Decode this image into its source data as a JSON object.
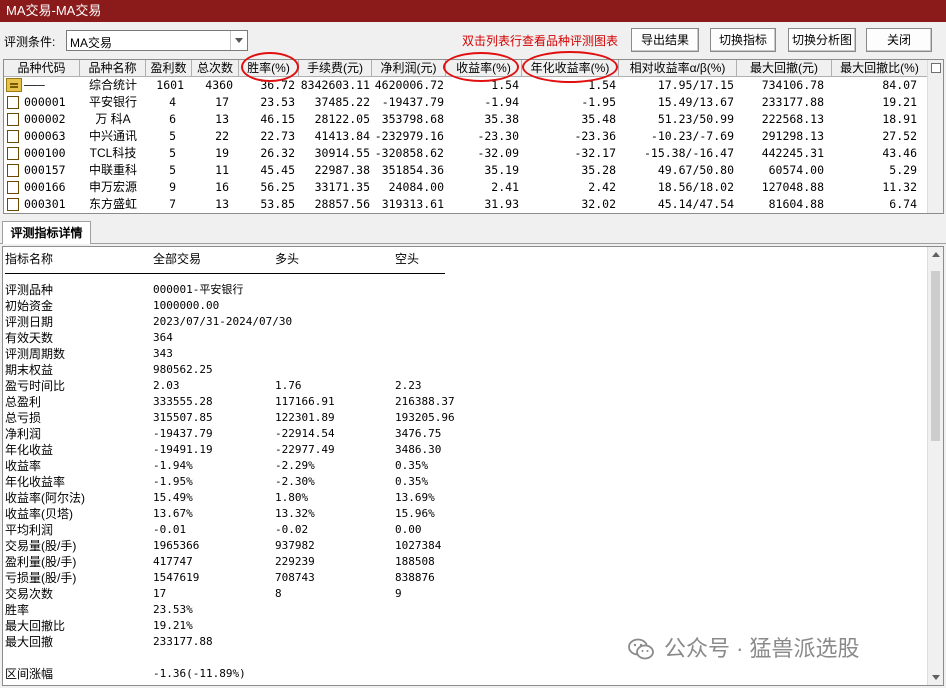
{
  "window": {
    "title": "MA交易-MA交易"
  },
  "toolbar": {
    "condition_label": "评测条件:",
    "condition_value": "MA交易",
    "hint": "双击列表行查看品种评测图表",
    "export_label": "导出结果",
    "switch_indicator_label": "切换指标",
    "switch_chart_label": "切换分析图",
    "close_label": "关闭"
  },
  "grid": {
    "columns": [
      "品种代码",
      "品种名称",
      "盈利数",
      "总次数",
      "胜率(%)",
      "手续费(元)",
      "净利润(元)",
      "收益率(%)",
      "年化收益率(%)",
      "相对收益率α/β(%)",
      "最大回撤(元)",
      "最大回撤比(%)"
    ],
    "rows": [
      [
        "———",
        "综合统计",
        "1601",
        "4360",
        "36.72",
        "8342603.11",
        "4620006.72",
        "1.54",
        "1.54",
        "17.95/17.15",
        "734106.78",
        "84.07"
      ],
      [
        "000001",
        "平安银行",
        "4",
        "17",
        "23.53",
        "37485.22",
        "-19437.79",
        "-1.94",
        "-1.95",
        "15.49/13.67",
        "233177.88",
        "19.21"
      ],
      [
        "000002",
        "万 科A",
        "6",
        "13",
        "46.15",
        "28122.05",
        "353798.68",
        "35.38",
        "35.48",
        "51.23/50.99",
        "222568.13",
        "18.91"
      ],
      [
        "000063",
        "中兴通讯",
        "5",
        "22",
        "22.73",
        "41413.84",
        "-232979.16",
        "-23.30",
        "-23.36",
        "-10.23/-7.69",
        "291298.13",
        "27.52"
      ],
      [
        "000100",
        "TCL科技",
        "5",
        "19",
        "26.32",
        "30914.55",
        "-320858.62",
        "-32.09",
        "-32.17",
        "-15.38/-16.47",
        "442245.31",
        "43.46"
      ],
      [
        "000157",
        "中联重科",
        "5",
        "11",
        "45.45",
        "22987.38",
        "351854.36",
        "35.19",
        "35.28",
        "49.67/50.80",
        "60574.00",
        "5.29"
      ],
      [
        "000166",
        "申万宏源",
        "9",
        "16",
        "56.25",
        "33171.35",
        "24084.00",
        "2.41",
        "2.42",
        "18.56/18.02",
        "127048.88",
        "11.32"
      ],
      [
        "000301",
        "东方盛虹",
        "7",
        "13",
        "53.85",
        "28857.56",
        "319313.61",
        "31.93",
        "32.02",
        "45.14/47.54",
        "81604.88",
        "6.74"
      ]
    ]
  },
  "tabs": {
    "detail_label": "评测指标详情"
  },
  "detail": {
    "headers": [
      "指标名称",
      "全部交易",
      "多头",
      "空头"
    ],
    "rows": [
      [
        "评测品种",
        "000001-平安银行",
        "",
        ""
      ],
      [
        "初始资金",
        "1000000.00",
        "",
        ""
      ],
      [
        "评测日期",
        "2023/07/31-2024/07/30",
        "",
        ""
      ],
      [
        "有效天数",
        "364",
        "",
        ""
      ],
      [
        "评测周期数",
        "343",
        "",
        ""
      ],
      [
        "期末权益",
        "980562.25",
        "",
        ""
      ],
      [
        "盈亏时间比",
        "2.03",
        "1.76",
        "2.23"
      ],
      [
        "总盈利",
        "333555.28",
        "117166.91",
        "216388.37"
      ],
      [
        "总亏损",
        "315507.85",
        "122301.89",
        "193205.96"
      ],
      [
        "净利润",
        "-19437.79",
        "-22914.54",
        "3476.75"
      ],
      [
        "年化收益",
        "-19491.19",
        "-22977.49",
        "3486.30"
      ],
      [
        "收益率",
        "-1.94%",
        "-2.29%",
        "0.35%"
      ],
      [
        "年化收益率",
        "-1.95%",
        "-2.30%",
        "0.35%"
      ],
      [
        "收益率(阿尔法)",
        "15.49%",
        "1.80%",
        "13.69%"
      ],
      [
        "收益率(贝塔)",
        "13.67%",
        "13.32%",
        "15.96%"
      ],
      [
        "平均利润",
        "-0.01",
        "-0.02",
        "0.00"
      ],
      [
        "交易量(股/手)",
        "1965366",
        "937982",
        "1027384"
      ],
      [
        "盈利量(股/手)",
        "417747",
        "229239",
        "188508"
      ],
      [
        "亏损量(股/手)",
        "1547619",
        "708743",
        "838876"
      ],
      [
        "交易次数",
        "17",
        "8",
        "9"
      ],
      [
        "胜率",
        "23.53%",
        "",
        ""
      ],
      [
        "最大回撤比",
        "19.21%",
        "",
        ""
      ],
      [
        "最大回撤",
        "233177.88",
        "",
        ""
      ],
      [
        "",
        "",
        " ",
        ""
      ],
      [
        "区间涨幅",
        "-1.36(-11.89%)",
        "",
        ""
      ]
    ]
  },
  "watermark": {
    "text": "公众号 · 猛兽派选股"
  },
  "colors": {
    "titlebar": "#8b1a1a",
    "hint": "#d40000",
    "annotation": "#e01010"
  }
}
